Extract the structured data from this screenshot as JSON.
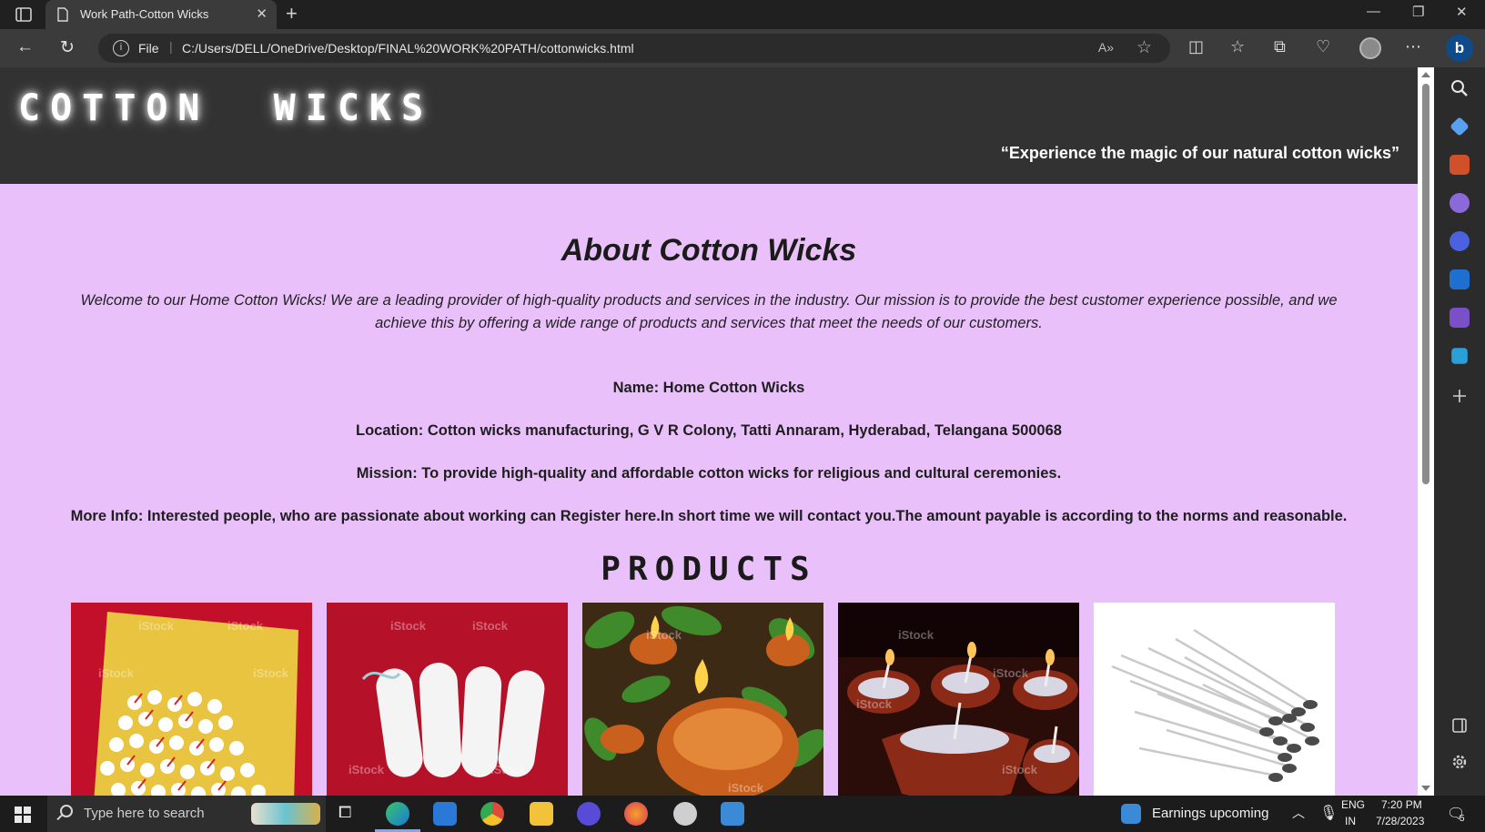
{
  "browser": {
    "tab_title": "Work Path-Cotton Wicks",
    "tab_close": "✕",
    "new_tab": "+",
    "url_scheme": "File",
    "url": "C:/Users/DELL/OneDrive/Desktop/FINAL%20WORK%20PATH/cottonwicks.html",
    "window_controls": [
      "—",
      "❐",
      "✕"
    ]
  },
  "site": {
    "logo": "COTTON  WICKS",
    "tagline": "“Experience the magic of our natural cotton wicks”",
    "about_title": "About Cotton Wicks",
    "about_text": "Welcome to our Home Cotton Wicks! We are a leading provider of high-quality products and services in the industry. Our mission is to provide the best customer experience possible, and we achieve this by offering a wide range of products and services that meet the needs of our customers.",
    "name_line": "Name: Home Cotton Wicks",
    "location_line": "Location: Cotton wicks manufacturing, G V R Colony, Tatti Annaram, Hyderabad, Telangana 500068",
    "mission_line": "Mission: To provide high-quality and affordable cotton wicks for religious and cultural ceremonies.",
    "more_info_line": "More Info: Interested people, who are passionate about working can Register here.In short time we will contact you.The amount payable is according to the norms and reasonable.",
    "products_title": "PRODUCTS",
    "watermark": "iStock"
  },
  "taskbar": {
    "search_placeholder": "Type here to search",
    "news": "Earnings upcoming",
    "lang_top": "ENG",
    "lang_bottom": "IN",
    "time": "7:20 PM",
    "date": "7/28/2023",
    "notifications": "5"
  },
  "colors": {
    "page_bg": "#eac0fb",
    "header_bg": "#323232",
    "browser_chrome": "#3b3b3b"
  }
}
